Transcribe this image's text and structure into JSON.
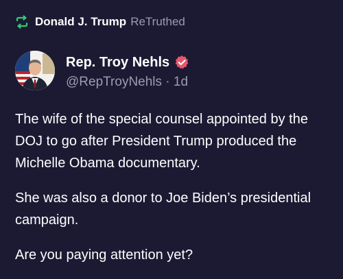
{
  "retruth": {
    "icon": "retruth-icon",
    "icon_color": "#2ecc71",
    "user": "Donald J. Trump",
    "label": "ReTruthed"
  },
  "author": {
    "avatar_icon": "avatar-photo",
    "name": "Rep. Troy Nehls",
    "verified_icon": "verified-badge-icon",
    "verified_color": "#e8566d",
    "handle": "@RepTroyNehls",
    "separator": "·",
    "time": "1d"
  },
  "post": {
    "paragraphs": [
      "The wife of the special counsel appointed by the DOJ to go after President Trump produced the Michelle Obama documentary.",
      "She was also a donor to Joe Biden’s presidential campaign.",
      "Are you paying attention yet?"
    ]
  },
  "colors": {
    "background": "#1c1a33",
    "text_primary": "#ffffff",
    "text_secondary": "#9d9bb3"
  }
}
